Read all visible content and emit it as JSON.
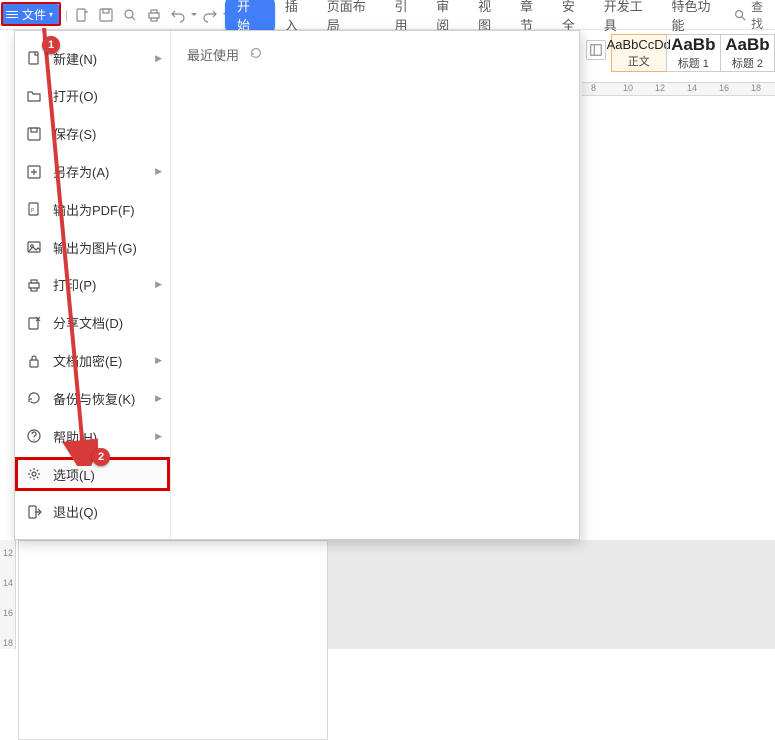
{
  "toolbar": {
    "file_label": "文件"
  },
  "tabs": {
    "start": "开始",
    "insert": "插入",
    "layout": "页面布局",
    "reference": "引用",
    "review": "审阅",
    "view": "视图",
    "chapter": "章节",
    "security": "安全",
    "dev": "开发工具",
    "special": "特色功能",
    "search": "查找"
  },
  "styles": {
    "body_prev": "AaBbCcDd",
    "body_label": "正文",
    "h1_prev": "AaBb",
    "h1_label": "标题 1",
    "h2_prev": "AaBb",
    "h2_label": "标题 2"
  },
  "ruler": {
    "n8": "8",
    "n10": "10",
    "n12": "12",
    "n14": "14",
    "n16": "16",
    "n18": "18"
  },
  "vruler": {
    "n12": "12",
    "n14": "14",
    "n16": "16",
    "n18": "18"
  },
  "recent": {
    "title": "最近使用"
  },
  "menu": {
    "new": "新建(N)",
    "open": "打开(O)",
    "save": "保存(S)",
    "saveas": "另存为(A)",
    "pdf": "输出为PDF(F)",
    "img": "输出为图片(G)",
    "print": "打印(P)",
    "share": "分享文档(D)",
    "encrypt": "文档加密(E)",
    "backup": "备份与恢复(K)",
    "help": "帮助(H)",
    "options": "选项(L)",
    "exit": "退出(Q)"
  },
  "annotations": {
    "badge1": "1",
    "badge2": "2"
  }
}
